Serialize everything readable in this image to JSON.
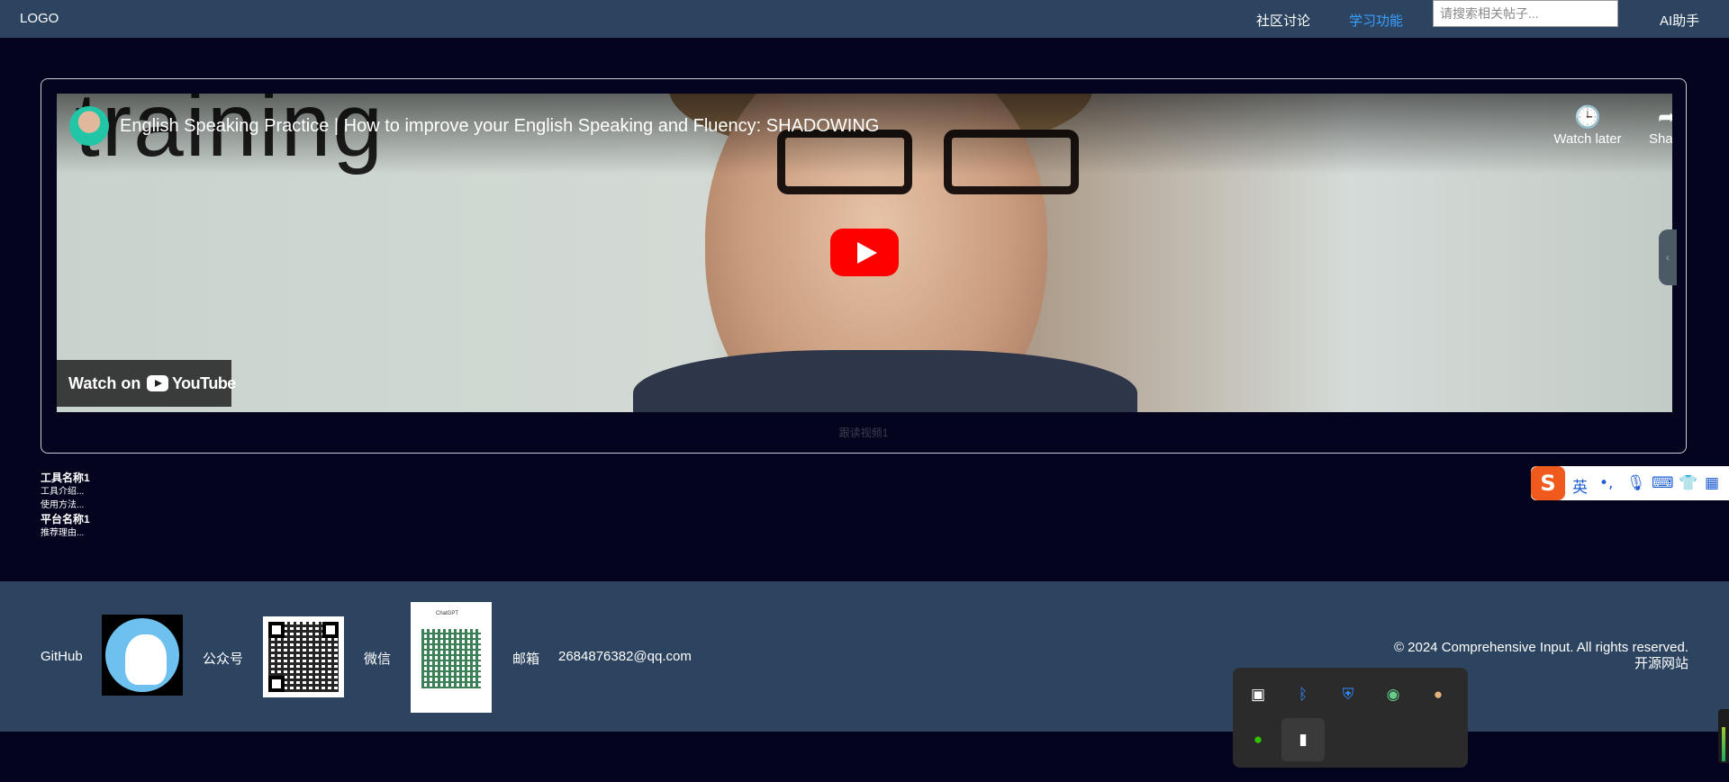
{
  "nav": {
    "logo": "LOGO",
    "links": [
      "社区讨论",
      "学习功能"
    ],
    "active_link": "学习功能",
    "search_placeholder": "请搜索相关帖子...",
    "ai_assistant": "AI助手"
  },
  "video": {
    "title": "English Speaking Practice | How to improve your English Speaking and Fluency: SHADOWING",
    "background_text": "training",
    "watch_later": "Watch later",
    "share": "Share",
    "watch_on": "Watch on",
    "youtube": "YouTube",
    "caption": "跟读视频1"
  },
  "tools": [
    {
      "name": "工具名称1",
      "lines": [
        "工具介绍...",
        "使用方法..."
      ]
    },
    {
      "name": "平台名称1",
      "lines": [
        "推荐理由..."
      ]
    }
  ],
  "ime": {
    "logo": "S",
    "mode": "英",
    "punct": "•,"
  },
  "footer": {
    "github": "GitHub",
    "gongzhonghao": "公众号",
    "wechat": "微信",
    "email_label": "邮箱",
    "email": "2684876382@qq.com",
    "copyright": "© 2024 Comprehensive Input. All rights reserved.",
    "open_source": "开源网站",
    "wechat_qr_name": "ChatGPT"
  },
  "tray": {
    "icons": [
      "calendar-icon",
      "bluetooth-icon",
      "security-warning-icon",
      "owl-app-icon",
      "cat-app-icon",
      "wechat-icon",
      "bookmark-app-icon"
    ]
  },
  "colors": {
    "background": "#04041f",
    "nav": "#2c4460",
    "accent": "#3aa0ff",
    "youtube_red": "#ff0000"
  }
}
